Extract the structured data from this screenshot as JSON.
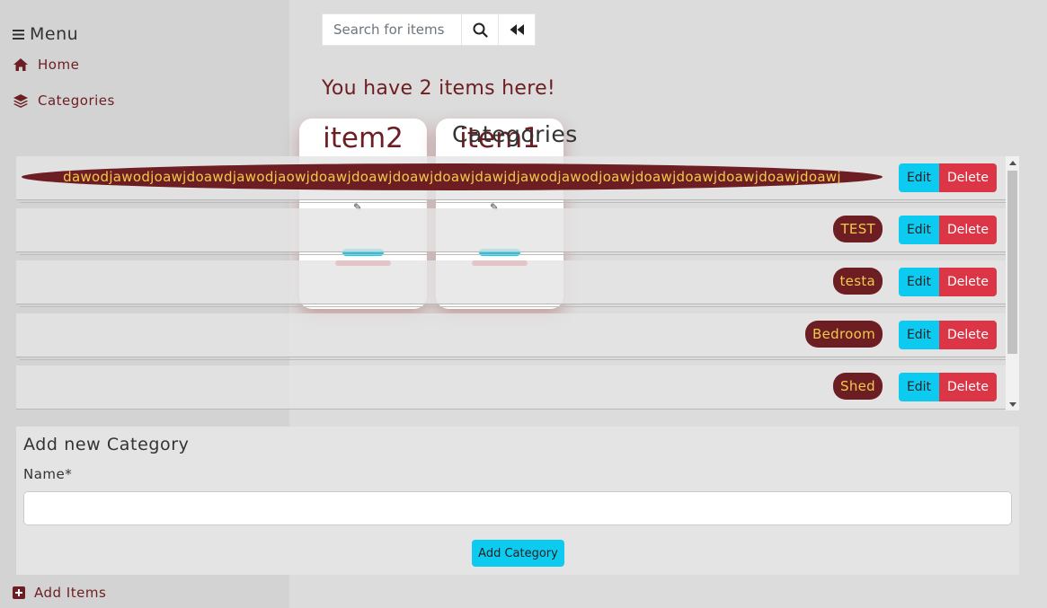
{
  "sidebar": {
    "menu_label": "Menu",
    "items": [
      {
        "label": "Home",
        "icon": "home-icon"
      },
      {
        "label": "Categories",
        "icon": "layers-icon"
      }
    ],
    "add_items_label": "Add Items"
  },
  "search": {
    "placeholder": "Search for items"
  },
  "main": {
    "item_count_text": "You have 2 items here!",
    "items": [
      {
        "title": "item2"
      },
      {
        "title": "item1"
      }
    ],
    "categories_heading": "Categories"
  },
  "categories": [
    {
      "name": "dawodjawodjoawjdoawdjawodjaowjdoawjdoawjdoawjdoawjdawjdjawodjawodjoawjdoawjdoawjdoawjdoawjdoawj"
    },
    {
      "name": "TEST"
    },
    {
      "name": "testa"
    },
    {
      "name": "Bedroom"
    },
    {
      "name": "Shed"
    }
  ],
  "buttons": {
    "edit": "Edit",
    "delete": "Delete"
  },
  "add_category": {
    "title": "Add new Category",
    "name_label": "Name*",
    "name_value": "",
    "submit_label": "Add Category"
  },
  "colors": {
    "brand": "#6d1e22",
    "badge_text": "#f2c94c",
    "edit": "#0dcaf0",
    "delete": "#dc3545"
  }
}
